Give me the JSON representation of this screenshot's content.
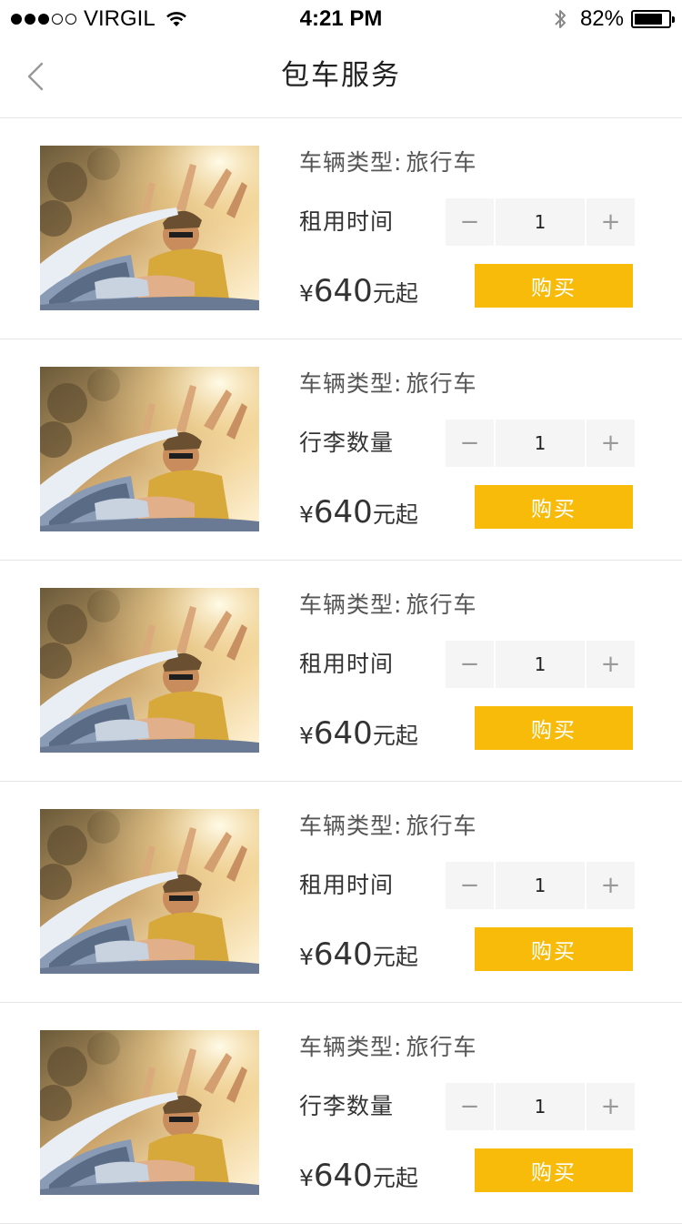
{
  "status_bar": {
    "carrier": "VIRGIL",
    "time": "4:21 PM",
    "battery": "82%",
    "battery_level": 0.82
  },
  "nav": {
    "title": "包车服务",
    "back_icon": "chevron-left-icon"
  },
  "items": [
    {
      "type_label": "车辆类型:",
      "type_value": "旅行车",
      "option_label": "租用时间",
      "quantity": "1",
      "currency": "¥",
      "price": "640",
      "price_suffix": "元起",
      "buy_label": "购买",
      "minus": "−",
      "plus": "+"
    },
    {
      "type_label": "车辆类型:",
      "type_value": "旅行车",
      "option_label": "行李数量",
      "quantity": "1",
      "currency": "¥",
      "price": "640",
      "price_suffix": "元起",
      "buy_label": "购买",
      "minus": "−",
      "plus": "+"
    },
    {
      "type_label": "车辆类型:",
      "type_value": "旅行车",
      "option_label": "租用时间",
      "quantity": "1",
      "currency": "¥",
      "price": "640",
      "price_suffix": "元起",
      "buy_label": "购买",
      "minus": "−",
      "plus": "+"
    },
    {
      "type_label": "车辆类型:",
      "type_value": "旅行车",
      "option_label": "租用时间",
      "quantity": "1",
      "currency": "¥",
      "price": "640",
      "price_suffix": "元起",
      "buy_label": "购买",
      "minus": "−",
      "plus": "+"
    },
    {
      "type_label": "车辆类型:",
      "type_value": "旅行车",
      "option_label": "行李数量",
      "quantity": "1",
      "currency": "¥",
      "price": "640",
      "price_suffix": "元起",
      "buy_label": "购买",
      "minus": "−",
      "plus": "+"
    }
  ],
  "colors": {
    "accent": "#f8bb0a",
    "stepper_bg": "#f5f5f5",
    "divider": "#e6e6e6"
  }
}
